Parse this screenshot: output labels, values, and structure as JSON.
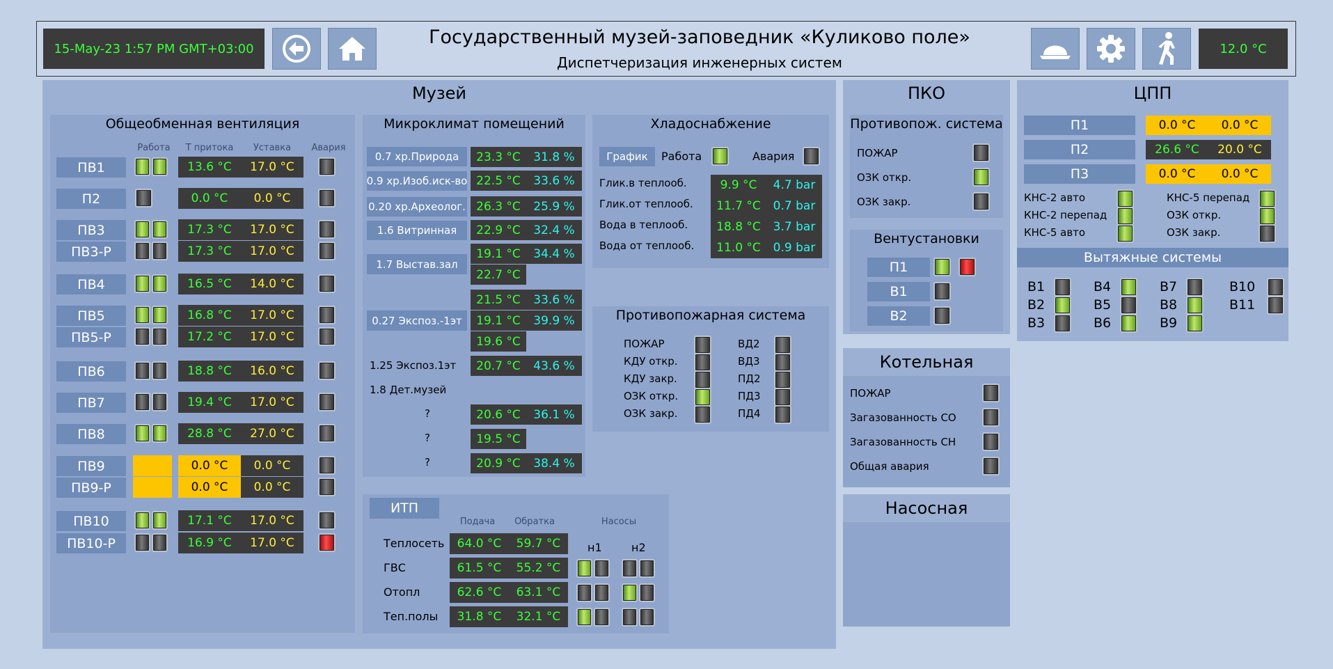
{
  "header": {
    "datetime": "15-May-23 1:57 PM GMT+03:00",
    "title": "Государственный музей-заповедник «Куликово поле»",
    "subtitle": "Диспетчеризация инженерных систем",
    "temperature": "12.0 °C"
  },
  "museum": {
    "title": "Музей"
  },
  "ventilation": {
    "title": "Общеобменная вентиляция",
    "col_work": "Работа",
    "col_supply": "Т притока",
    "col_setpoint": "Уставка",
    "col_alarm": "Авария",
    "rows": [
      {
        "name": "ПВ1",
        "t": "13.6 °C",
        "s": "17.0 °C",
        "work": [
          "on",
          "on"
        ],
        "alarm": "off"
      },
      {
        "name": "П2",
        "t": "0.0 °C",
        "s": "0.0 °C",
        "work": [
          "off"
        ],
        "alarm": "off"
      },
      {
        "name": "ПВ3",
        "t": "17.3 °C",
        "s": "17.0 °C",
        "work": [
          "on",
          "on"
        ],
        "alarm": "off"
      },
      {
        "name": "ПВ3-Р",
        "t": "17.3 °C",
        "s": "17.0 °C",
        "work": [
          "off",
          "off"
        ],
        "alarm": "off"
      },
      {
        "name": "ПВ4",
        "t": "16.5 °C",
        "s": "14.0 °C",
        "work": [
          "on",
          "on"
        ],
        "alarm": "off"
      },
      {
        "name": "ПВ5",
        "t": "16.8 °C",
        "s": "17.0 °C",
        "work": [
          "on",
          "on"
        ],
        "alarm": "off"
      },
      {
        "name": "ПВ5-Р",
        "t": "17.2 °C",
        "s": "17.0 °C",
        "work": [
          "off",
          "off"
        ],
        "alarm": "off"
      },
      {
        "name": "ПВ6",
        "t": "18.8 °C",
        "s": "16.0 °C",
        "work": [
          "off",
          "off"
        ],
        "alarm": "off"
      },
      {
        "name": "ПВ7",
        "t": "19.4 °C",
        "s": "17.0 °C",
        "work": [
          "off",
          "off"
        ],
        "alarm": "off"
      },
      {
        "name": "ПВ8",
        "t": "28.8 °C",
        "s": "27.0 °C",
        "work": [
          "on",
          "on"
        ],
        "alarm": "off"
      },
      {
        "name": "ПВ9",
        "t": "0.0 °C",
        "s": "0.0 °C",
        "work": [
          "fault"
        ],
        "alarm": "off",
        "fault": true
      },
      {
        "name": "ПВ9-Р",
        "t": "0.0 °C",
        "s": "0.0 °C",
        "work": [
          "fault"
        ],
        "alarm": "off",
        "fault": true
      },
      {
        "name": "ПВ10",
        "t": "17.1 °C",
        "s": "17.0 °C",
        "work": [
          "on",
          "on"
        ],
        "alarm": "off"
      },
      {
        "name": "ПВ10-Р",
        "t": "16.9 °C",
        "s": "17.0 °C",
        "work": [
          "off",
          "off"
        ],
        "alarm": "alarm"
      }
    ]
  },
  "microclimate": {
    "title": "Микроклимат помещений",
    "rows": [
      {
        "room": "0.7 хр.Природа",
        "t": "23.3 °C",
        "h": "31.8 %"
      },
      {
        "room": "0.9 хр.Изоб.иск-во",
        "t": "22.5 °C",
        "h": "33.6 %"
      },
      {
        "room": "0.20 хр.Археолог.",
        "t": "26.3 °C",
        "h": "25.9 %"
      },
      {
        "room": "1.6 Витринная",
        "t": "22.9 °C",
        "h": "32.4 %"
      },
      {
        "room": "1.7 Выстав.зал",
        "t": "19.1 °C",
        "h": "34.4 %"
      },
      {
        "room": "",
        "t": "22.7 °C",
        "h": ""
      },
      {
        "room": "",
        "t": "21.5 °C",
        "h": "33.6 %"
      },
      {
        "room": "0.27 Экспоз.-1эт",
        "t": "19.1 °C",
        "h": "39.9 %"
      },
      {
        "room": "",
        "t": "19.6 °C",
        "h": ""
      },
      {
        "room": "1.25 Экспоз.1эт",
        "t": "20.7 °C",
        "h": "43.6 %"
      },
      {
        "room": "1.8 Дет.музей",
        "t": "",
        "h": ""
      },
      {
        "room": "?",
        "t": "20.6 °C",
        "h": "36.1 %"
      },
      {
        "room": "?",
        "t": "19.5 °C",
        "h": ""
      },
      {
        "room": "?",
        "t": "20.9 °C",
        "h": "38.4 %"
      }
    ]
  },
  "cooling": {
    "title": "Хладоснабжение",
    "chart_button": "График",
    "work_label": "Работа",
    "alarm_label": "Авария",
    "rows": [
      {
        "label": "Глик.в теплооб.",
        "t": "9.9 °C",
        "p": "4.7 bar"
      },
      {
        "label": "Глик.от теплооб.",
        "t": "11.7 °C",
        "p": "0.7 bar"
      },
      {
        "label": "Вода в теплооб.",
        "t": "18.8 °C",
        "p": "3.7 bar"
      },
      {
        "label": "Вода от теплооб.",
        "t": "11.0 °C",
        "p": "0.9 bar"
      }
    ]
  },
  "fire_system": {
    "title": "Противопожарная система",
    "left": [
      {
        "label": "ПОЖАР",
        "state": "off"
      },
      {
        "label": "КДУ откр.",
        "state": "off"
      },
      {
        "label": "КДУ закр.",
        "state": "off"
      },
      {
        "label": "ОЗК откр.",
        "state": "on"
      },
      {
        "label": "ОЗК закр.",
        "state": "off"
      }
    ],
    "right": [
      {
        "label": "ВД2",
        "state": "off"
      },
      {
        "label": "ВД3",
        "state": "off"
      },
      {
        "label": "ПД2",
        "state": "off"
      },
      {
        "label": "ПД3",
        "state": "off"
      },
      {
        "label": "ПД4",
        "state": "off"
      }
    ]
  },
  "itp": {
    "title": "ИТП",
    "col_supply": "Подача",
    "col_return": "Обратка",
    "col_pumps": "Насосы",
    "pump1": "н1",
    "pump2": "н2",
    "rows": [
      {
        "label": "Теплосеть",
        "s": "64.0 °C",
        "r": "59.7 °C",
        "n1": null,
        "n2": null
      },
      {
        "label": "ГВС",
        "s": "61.5 °C",
        "r": "55.2 °C",
        "n1": [
          "on",
          "off"
        ],
        "n2": [
          "off",
          "off"
        ]
      },
      {
        "label": "Отопл",
        "s": "62.6 °C",
        "r": "63.1 °C",
        "n1": [
          "off",
          "off"
        ],
        "n2": [
          "on",
          "off"
        ]
      },
      {
        "label": "Теп.полы",
        "s": "31.8 °C",
        "r": "32.1 °C",
        "n1": [
          "on",
          "off"
        ],
        "n2": [
          "off",
          "off"
        ]
      }
    ]
  },
  "pko": {
    "title": "ПКО",
    "fire": {
      "title": "Противопож. система",
      "items": [
        {
          "label": "ПОЖАР",
          "state": "off"
        },
        {
          "label": "ОЗК откр.",
          "state": "on"
        },
        {
          "label": "ОЗК закр.",
          "state": "off"
        }
      ]
    },
    "vent": {
      "title": "Вентустановки",
      "items": [
        {
          "label": "П1",
          "states": [
            "on",
            "alarm"
          ]
        },
        {
          "label": "В1",
          "states": [
            "off"
          ]
        },
        {
          "label": "В2",
          "states": [
            "off"
          ]
        }
      ]
    }
  },
  "boiler": {
    "title": "Котельная",
    "items": [
      {
        "label": "ПОЖАР",
        "state": "off"
      },
      {
        "label": "Загазованность СО",
        "state": "off"
      },
      {
        "label": "Загазованность СН",
        "state": "off"
      },
      {
        "label": "Общая авария",
        "state": "off"
      }
    ]
  },
  "pump_station": {
    "title": "Насосная"
  },
  "cpp": {
    "title": "ЦПП",
    "units": [
      {
        "name": "П1",
        "t": "0.0 °C",
        "s": "0.0 °C",
        "fault": true
      },
      {
        "name": "П2",
        "t": "26.6 °C",
        "s": "20.0 °C",
        "fault": false
      },
      {
        "name": "П3",
        "t": "0.0 °C",
        "s": "0.0 °C",
        "fault": true
      }
    ],
    "status_left": [
      {
        "label": "КНС-2 авто",
        "state": "on"
      },
      {
        "label": "КНС-2 перепад",
        "state": "on"
      },
      {
        "label": "КНС-5 авто",
        "state": "on"
      }
    ],
    "status_right": [
      {
        "label": "КНС-5 перепад",
        "state": "on"
      },
      {
        "label": "ОЗК откр.",
        "state": "on"
      },
      {
        "label": "ОЗК закр.",
        "state": "off"
      }
    ],
    "exhaust": {
      "title": "Вытяжные системы",
      "items": [
        {
          "label": "В1",
          "state": "off"
        },
        {
          "label": "В2",
          "state": "on"
        },
        {
          "label": "В3",
          "state": "off"
        },
        {
          "label": "В4",
          "state": "on"
        },
        {
          "label": "В5",
          "state": "off"
        },
        {
          "label": "В6",
          "state": "on"
        },
        {
          "label": "В7",
          "state": "off"
        },
        {
          "label": "В8",
          "state": "on"
        },
        {
          "label": "В9",
          "state": "on"
        },
        {
          "label": "В10",
          "state": "off"
        },
        {
          "label": "В11",
          "state": "off"
        }
      ]
    }
  }
}
